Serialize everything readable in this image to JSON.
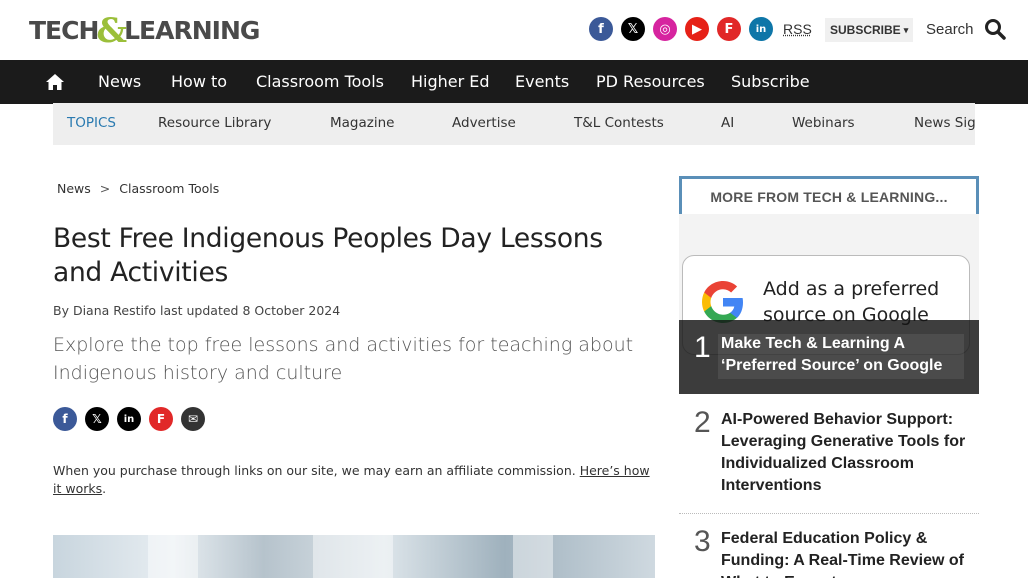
{
  "header": {
    "logo_left": "TECH",
    "logo_amp": "&",
    "logo_right": "LEARNING",
    "social": [
      {
        "icon": "facebook-icon",
        "glyph": "f"
      },
      {
        "icon": "x-icon",
        "glyph": "𝕏"
      },
      {
        "icon": "instagram-icon",
        "glyph": "◎"
      },
      {
        "icon": "youtube-icon",
        "glyph": "▶"
      },
      {
        "icon": "flipboard-icon",
        "glyph": "F"
      },
      {
        "icon": "linkedin-icon",
        "glyph": "in"
      }
    ],
    "rss_label": "RSS",
    "subscribe_label": "SUBSCRIBE",
    "subscribe_caret": "▾",
    "search_label": "Search"
  },
  "nav": {
    "items": [
      "News",
      "How to",
      "Classroom Tools",
      "Higher Ed",
      "Events",
      "PD Resources",
      "Subscribe"
    ]
  },
  "topics": {
    "label": "TOPICS",
    "items": [
      "Resource Library",
      "Magazine",
      "Advertise",
      "T&L Contests",
      "AI",
      "Webinars",
      "News Sig"
    ]
  },
  "breadcrumb": {
    "items": [
      "News",
      "Classroom Tools"
    ],
    "separator": ">"
  },
  "article": {
    "title": "Best Free Indigenous Peoples Day Lessons and Activities",
    "byline": "By Diana Restifo last updated 8 October 2024",
    "standfirst": "Explore the top free lessons and activities for teaching about Indigenous history and culture",
    "share": [
      {
        "icon": "facebook-share-icon",
        "glyph": "f"
      },
      {
        "icon": "x-share-icon",
        "glyph": "𝕏"
      },
      {
        "icon": "linkedin-share-icon",
        "glyph": "in"
      },
      {
        "icon": "flipboard-share-icon",
        "glyph": "F"
      },
      {
        "icon": "email-share-icon",
        "glyph": "✉"
      }
    ],
    "affiliate_text": "When you purchase through links on our site, we may earn an affiliate commission. ",
    "affiliate_link": "Here’s how it works",
    "affiliate_end": "."
  },
  "sidebar": {
    "heading": "MORE FROM TECH & LEARNING...",
    "promo_text": "Add as a preferred source on Google",
    "items": [
      {
        "num": "1",
        "title": "Make Tech & Learning A ‘Preferred Source’ on Google"
      },
      {
        "num": "2",
        "title": "AI-Powered Behavior Support: Leveraging Generative Tools for Individualized Classroom Interventions"
      },
      {
        "num": "3",
        "title": "Federal Education Policy & Funding: A Real-Time Review of What to Expect"
      }
    ]
  },
  "colors": {
    "nav_bg": "#1b1b1b",
    "topics_bg": "#eeeeee",
    "topics_label": "#2a7ab0",
    "sidebar_border": "#5a8fb8",
    "logo_amp": "#9bbf3a"
  }
}
